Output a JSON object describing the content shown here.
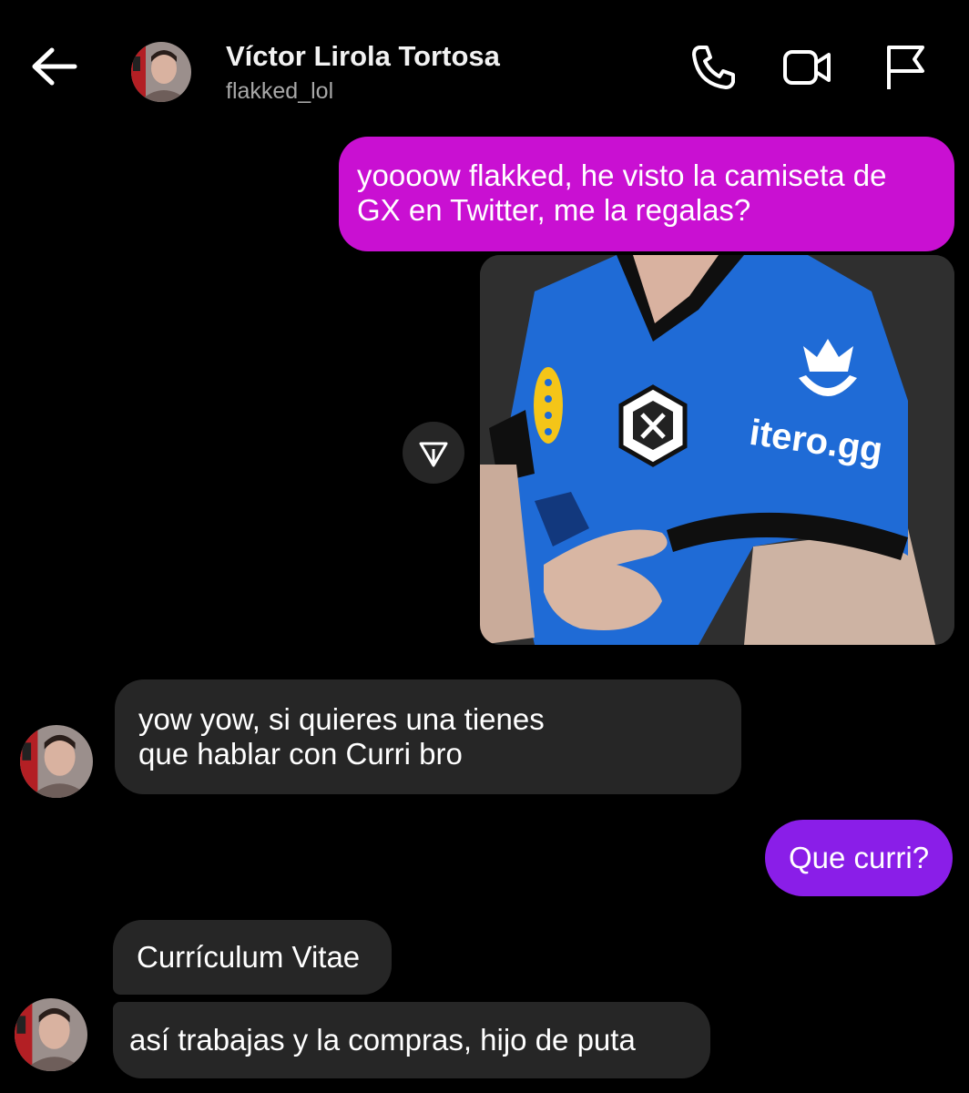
{
  "header": {
    "name": "Víctor Lirola Tortosa",
    "username": "flakked_lol",
    "icons": [
      "back-arrow-icon",
      "phone-icon",
      "video-camera-icon",
      "flag-icon"
    ]
  },
  "messages": {
    "sent_1": "yoooow flakked, he visto la camiseta de GX en Twitter, me la regalas?",
    "received_1": [
      "yow yow, si quieres una tienes",
      "que hablar con Curri bro"
    ],
    "sent_2": "Que curri?",
    "received_2": "Currículum Vitae",
    "received_3": "así trabajas y la compras, hijo de puta"
  },
  "shared_image": {
    "alt_labels": [
      "itero.gg"
    ],
    "share_icon": "send-paper-plane-icon"
  },
  "colors": {
    "background": "#000000",
    "sent_bubble_1": "#c910d2",
    "sent_bubble_2": "#8a1ee8",
    "received_bubble": "#262626",
    "jersey_blue": "#1f6bd6",
    "text_secondary": "#a8a8a8"
  }
}
